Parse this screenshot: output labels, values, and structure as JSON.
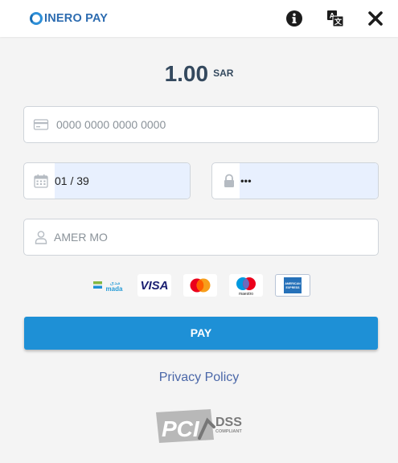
{
  "header": {
    "brand": "INERO PAY",
    "info_icon": "info-circle-icon",
    "translate_icon": "translate-icon",
    "close_icon": "close-icon"
  },
  "payment": {
    "amount": "1.00",
    "currency": "SAR"
  },
  "form": {
    "card_number_placeholder": "0000 0000 0000 0000",
    "expiry_value": "01 / 39",
    "cvv_value": "•••",
    "name_value": "AMER MO"
  },
  "card_brands": [
    "mada",
    "VISA",
    "mastercard",
    "maestro",
    "AMERICAN EXPRESS"
  ],
  "mada_arabic": "مدى",
  "maestro_text": "maestro",
  "pay_label": "PAY",
  "privacy_label": "Privacy Policy",
  "pci": {
    "pci_text": "PCI",
    "dss_text": "DSS",
    "compliant_text": "COMPLIANT"
  },
  "colors": {
    "accent": "#1e90d6",
    "brand": "#2d6cb0",
    "link": "#4a67a8",
    "autofill": "#e8f0fe"
  }
}
